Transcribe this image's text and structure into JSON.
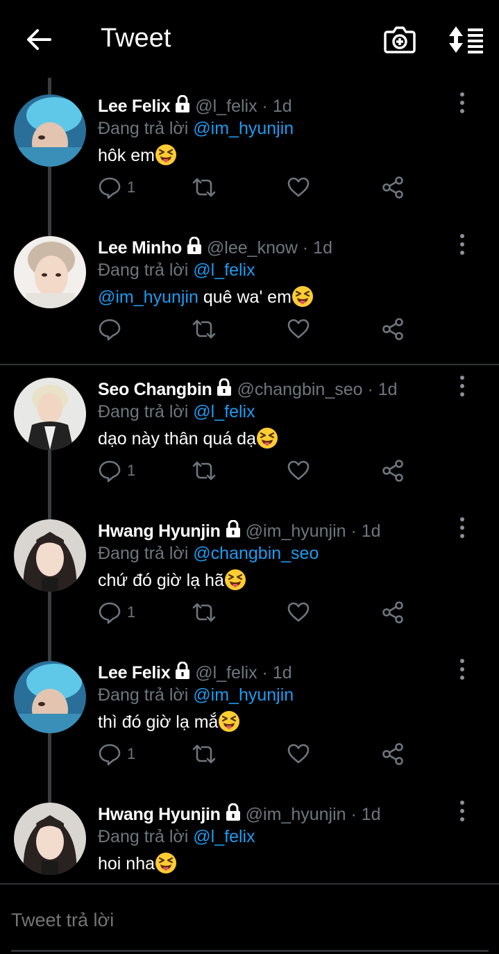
{
  "header": {
    "title": "Tweet",
    "back_icon": "back-arrow-icon",
    "camera_icon": "camera-add-icon",
    "sort_icon": "sort-icon"
  },
  "colors": {
    "background": "#000000",
    "text": "#ffffff",
    "muted": "#6e767d",
    "link": "#1d9bf0",
    "divider": "#2f3336"
  },
  "replying_label": "Đang trả lời",
  "tweets": [
    {
      "name": "Lee Felix",
      "handle": "@l_felix",
      "separator": "·",
      "time": "1d",
      "reply_to": "@im_hyunjin",
      "mention": "",
      "text": "hôk em",
      "emoji": "squinting-face-with-tongue",
      "reply_count": "1"
    },
    {
      "name": "Lee Minho",
      "handle": "@lee_know",
      "separator": "·",
      "time": "1d",
      "reply_to": "@l_felix",
      "mention": "@im_hyunjin",
      "text": " quê wa' em",
      "emoji": "squinting-face-with-tongue",
      "reply_count": ""
    },
    {
      "name": "Seo Changbin",
      "handle": "@changbin_seo",
      "separator": "·",
      "time": "1d",
      "reply_to": "@l_felix",
      "mention": "",
      "text": "dạo này thân quá dạ",
      "emoji": "squinting-face-with-tongue",
      "reply_count": "1"
    },
    {
      "name": "Hwang Hyunjin",
      "handle": "@im_hyunjin",
      "separator": "·",
      "time": "1d",
      "reply_to": "@changbin_seo",
      "mention": "",
      "text": "chứ đó giờ lạ hã",
      "emoji": "squinting-face-with-tongue",
      "reply_count": "1"
    },
    {
      "name": "Lee Felix",
      "handle": "@l_felix",
      "separator": "·",
      "time": "1d",
      "reply_to": "@im_hyunjin",
      "mention": "",
      "text": "thì đó giờ lạ mắ",
      "emoji": "squinting-face-with-tongue",
      "reply_count": "1"
    },
    {
      "name": "Hwang Hyunjin",
      "handle": "@im_hyunjin",
      "separator": "·",
      "time": "1d",
      "reply_to": "@l_felix",
      "mention": "",
      "text": "hoi nha",
      "emoji": "squinting-face-with-tongue",
      "reply_count": ""
    }
  ],
  "composer": {
    "placeholder": "Tweet trả lời"
  }
}
